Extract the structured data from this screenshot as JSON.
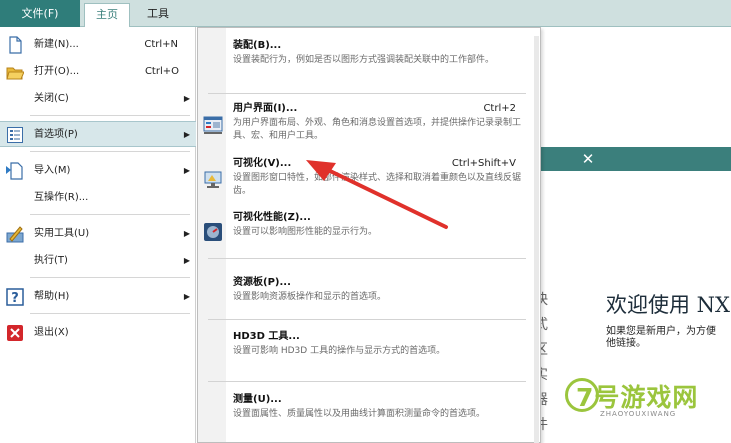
{
  "ribbon": {
    "file_tab": "文件(F)",
    "home_tab": "主页",
    "tools_tab": "工具"
  },
  "file_menu": {
    "items": [
      {
        "label": "新建(N)...",
        "shortcut": "Ctrl+N",
        "icon": "new-file-icon"
      },
      {
        "label": "打开(O)...",
        "shortcut": "Ctrl+O",
        "icon": "open-folder-icon"
      },
      {
        "label": "关闭(C)",
        "arrow": "▶"
      },
      {
        "label": "首选项(P)",
        "arrow": "▶",
        "icon": "preferences-icon",
        "selected": true
      },
      {
        "label": "导入(M)",
        "arrow": "▶",
        "icon": "import-icon"
      },
      {
        "label": "互操作(R)..."
      },
      {
        "label": "实用工具(U)",
        "arrow": "▶",
        "icon": "utilities-icon"
      },
      {
        "label": "执行(T)",
        "arrow": "▶"
      },
      {
        "label": "帮助(H)",
        "arrow": "▶",
        "icon": "help-icon"
      },
      {
        "label": "退出(X)",
        "icon": "exit-icon"
      }
    ]
  },
  "preferences_menu": {
    "items": [
      {
        "title": "装配(B)...",
        "desc": "设置装配行为，例如是否以图形方式强调装配关联中的工作部件。"
      },
      {
        "title": "用户界面(I)...",
        "shortcut": "Ctrl+2",
        "desc": "为用户界面布局、外观、角色和消息设置首选项，并提供操作记录录制工具、宏、和用户工具。",
        "icon": "user-interface-icon"
      },
      {
        "title": "可视化(V)...",
        "shortcut": "Ctrl+Shift+V",
        "desc": "设置图形窗口特性，如部件渲染样式、选择和取消着重颜色以及直线反锯齿。",
        "icon": "visualization-icon"
      },
      {
        "title": "可视化性能(Z)...",
        "desc": "设置可以影响图形性能的显示行为。",
        "icon": "visualization-performance-icon"
      },
      {
        "title": "资源板(P)...",
        "desc": "设置影响资源板操作和显示的首选项。"
      },
      {
        "title": "HD3D 工具...",
        "desc": "设置可影响 HD3D 工具的操作与显示方式的首选项。"
      },
      {
        "title": "测量(U)...",
        "desc": "设置面属性、质量属性以及用曲线计算面积测量命令的首选项。"
      }
    ]
  },
  "background": {
    "close_glyph": "✕",
    "side_chars": [
      "快",
      "式",
      "区",
      "实",
      "器",
      "件"
    ],
    "welcome_title": "欢迎使用 NX",
    "welcome_line1": "如果您是新用户，为方便",
    "welcome_line2": "他链接。",
    "watermark_main": "7号游戏网",
    "watermark_sub": "ZHAOYOUXIWANG"
  },
  "colors": {
    "ribbon_bg": "#cfe0df",
    "file_tab": "#2f7d7a",
    "selected_item": "#d7e7ea",
    "annotation_arrow": "#e0312b",
    "watermark": "#9bc53d"
  }
}
